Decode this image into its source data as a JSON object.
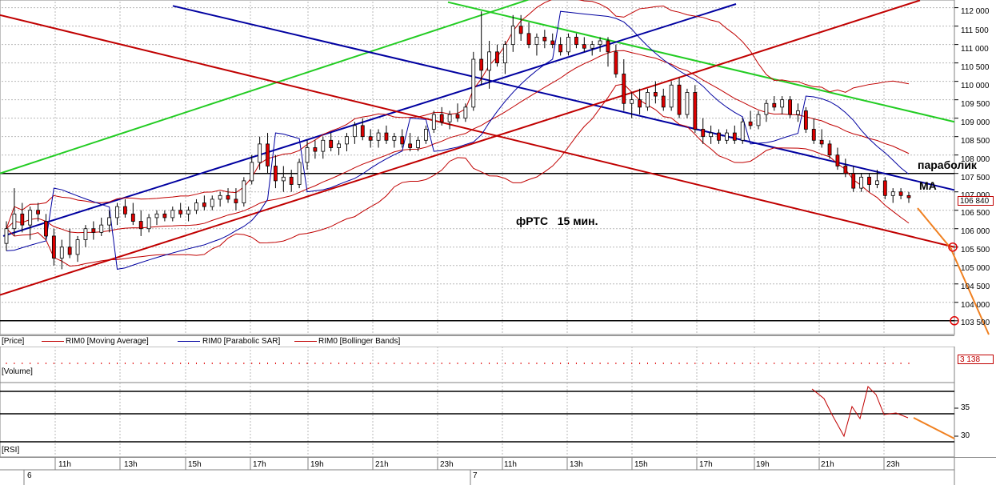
{
  "chart_data": {
    "type": "candlestick",
    "title": "фРТС   15 мин.",
    "instrument": "RIM0",
    "timeframe": "15 мин.",
    "price_axis": {
      "range": [
        103300,
        112100
      ],
      "ticks": [
        "112 000",
        "111 500",
        "111 000",
        "110 500",
        "110 000",
        "109 500",
        "109 000",
        "108 500",
        "108 000",
        "107 500",
        "107 000",
        "106 500",
        "106 000",
        "105 500",
        "105 000",
        "104 500",
        "104 000",
        "103 500"
      ],
      "tick_values": [
        112000,
        111500,
        111000,
        110500,
        110000,
        109500,
        109000,
        108500,
        108000,
        107500,
        107000,
        106500,
        106000,
        105500,
        105000,
        104500,
        104000,
        103500
      ],
      "last_price": "106 840"
    },
    "volume_axis": {
      "last_value": "3 138"
    },
    "rsi_axis": {
      "ticks": [
        "35",
        "30"
      ],
      "tick_values": [
        35,
        30
      ],
      "levels": [
        38,
        34,
        29
      ]
    },
    "time_axis": {
      "hours": [
        "11h",
        "13h",
        "15h",
        "17h",
        "19h",
        "21h",
        "23h",
        "11h",
        "13h",
        "15h",
        "17h",
        "19h",
        "21h",
        "23h"
      ],
      "days": [
        "6",
        "7"
      ]
    },
    "legend": [
      {
        "label": "[Price]",
        "color": "#000000"
      },
      {
        "label": "RIM0 [Moving Average]",
        "color": "#c00000"
      },
      {
        "label": "RIM0 [Parabolic SAR]",
        "color": "#0000a0"
      },
      {
        "label": "RIM0 [Bollinger Bands]",
        "color": "#c00000"
      }
    ],
    "pane_labels": {
      "volume": "[Volume]",
      "rsi": "[RSI]"
    },
    "annotations": {
      "parabolic": "параболик",
      "ma": "МА"
    },
    "candles": [
      [
        105600,
        106200,
        105400,
        106000
      ],
      [
        106000,
        107100,
        105800,
        106400
      ],
      [
        106400,
        106700,
        105900,
        106100
      ],
      [
        106100,
        106600,
        105700,
        106500
      ],
      [
        106500,
        106700,
        106200,
        106400
      ],
      [
        106200,
        106400,
        105700,
        105800
      ],
      [
        105800,
        106000,
        105000,
        105200
      ],
      [
        105200,
        105700,
        104900,
        105500
      ],
      [
        105500,
        106000,
        105200,
        105300
      ],
      [
        105300,
        105800,
        105100,
        105700
      ],
      [
        105700,
        106100,
        105500,
        106000
      ],
      [
        106000,
        106200,
        105700,
        105900
      ],
      [
        105900,
        106300,
        105800,
        106100
      ],
      [
        106100,
        106500,
        105900,
        106300
      ],
      [
        106300,
        106700,
        106100,
        106600
      ],
      [
        106600,
        106800,
        106300,
        106400
      ],
      [
        106400,
        106700,
        106100,
        106200
      ],
      [
        106200,
        106500,
        105800,
        106000
      ],
      [
        106000,
        106400,
        105900,
        106300
      ],
      [
        106300,
        106500,
        106100,
        106400
      ],
      [
        106400,
        106500,
        106200,
        106300
      ],
      [
        106300,
        106600,
        106200,
        106500
      ],
      [
        106500,
        106700,
        106300,
        106400
      ],
      [
        106400,
        106600,
        106200,
        106500
      ],
      [
        106500,
        106800,
        106400,
        106700
      ],
      [
        106700,
        106900,
        106500,
        106600
      ],
      [
        106600,
        106900,
        106500,
        106800
      ],
      [
        106800,
        107000,
        106600,
        106900
      ],
      [
        106900,
        107100,
        106700,
        106800
      ],
      [
        106800,
        107100,
        106500,
        106700
      ],
      [
        106700,
        107400,
        106600,
        107300
      ],
      [
        107300,
        108000,
        107200,
        107800
      ],
      [
        107800,
        108500,
        107600,
        108300
      ],
      [
        108300,
        108600,
        107500,
        107700
      ],
      [
        107700,
        108000,
        107100,
        107300
      ],
      [
        107300,
        107700,
        107000,
        107400
      ],
      [
        107400,
        107600,
        107000,
        107200
      ],
      [
        107200,
        107900,
        107100,
        107800
      ],
      [
        107800,
        108400,
        107600,
        108200
      ],
      [
        108200,
        108400,
        107900,
        108100
      ],
      [
        108100,
        108500,
        107900,
        108400
      ],
      [
        108400,
        108600,
        108100,
        108200
      ],
      [
        108200,
        108400,
        108000,
        108300
      ],
      [
        108300,
        108600,
        108100,
        108500
      ],
      [
        108500,
        108900,
        108300,
        108800
      ],
      [
        108800,
        109000,
        108400,
        108500
      ],
      [
        108500,
        108700,
        108200,
        108400
      ],
      [
        108400,
        108700,
        108200,
        108600
      ],
      [
        108600,
        108800,
        108300,
        108400
      ],
      [
        108400,
        108600,
        108200,
        108500
      ],
      [
        108500,
        108700,
        108200,
        108300
      ],
      [
        108300,
        108600,
        108100,
        108200
      ],
      [
        108200,
        108500,
        108100,
        108400
      ],
      [
        108400,
        108800,
        108300,
        108700
      ],
      [
        108700,
        109200,
        108600,
        109100
      ],
      [
        109100,
        109300,
        108800,
        108900
      ],
      [
        108900,
        109200,
        108700,
        109100
      ],
      [
        109100,
        109400,
        108900,
        109000
      ],
      [
        109000,
        109400,
        108900,
        109300
      ],
      [
        109300,
        110800,
        109200,
        110600
      ],
      [
        110600,
        111900,
        109900,
        110300
      ],
      [
        110300,
        111100,
        109800,
        110800
      ],
      [
        110800,
        111000,
        110400,
        110500
      ],
      [
        110500,
        111100,
        110200,
        111000
      ],
      [
        111000,
        111800,
        110800,
        111500
      ],
      [
        111500,
        111800,
        111100,
        111300
      ],
      [
        111300,
        111600,
        110900,
        111000
      ],
      [
        111000,
        111300,
        110700,
        111200
      ],
      [
        111200,
        111400,
        110900,
        111100
      ],
      [
        111100,
        111300,
        110900,
        111000
      ],
      [
        111000,
        111200,
        110700,
        110800
      ],
      [
        110800,
        111300,
        110700,
        111200
      ],
      [
        111200,
        111300,
        110900,
        111000
      ],
      [
        111000,
        111200,
        110800,
        110900
      ],
      [
        110900,
        111100,
        110700,
        111000
      ],
      [
        111000,
        111200,
        110800,
        111100
      ],
      [
        111100,
        111200,
        110400,
        110800
      ],
      [
        110800,
        111000,
        110100,
        110200
      ],
      [
        110200,
        110600,
        109200,
        109400
      ],
      [
        109400,
        109700,
        109000,
        109500
      ],
      [
        109500,
        109800,
        109100,
        109300
      ],
      [
        109300,
        109800,
        109200,
        109700
      ],
      [
        109700,
        110000,
        109400,
        109600
      ],
      [
        109600,
        109800,
        109200,
        109300
      ],
      [
        109300,
        110000,
        109200,
        109900
      ],
      [
        109900,
        110100,
        109000,
        109100
      ],
      [
        109100,
        109800,
        109000,
        109700
      ],
      [
        109700,
        109900,
        108600,
        108700
      ],
      [
        108700,
        109000,
        108300,
        108500
      ],
      [
        108500,
        108800,
        108300,
        108600
      ],
      [
        108600,
        108700,
        108300,
        108400
      ],
      [
        108400,
        108700,
        108300,
        108600
      ],
      [
        108600,
        108800,
        108300,
        108400
      ],
      [
        108400,
        109000,
        108300,
        108900
      ],
      [
        108900,
        109200,
        108700,
        108800
      ],
      [
        108800,
        109200,
        108700,
        109100
      ],
      [
        109100,
        109500,
        108900,
        109400
      ],
      [
        109400,
        109600,
        109200,
        109300
      ],
      [
        109300,
        109600,
        109100,
        109500
      ],
      [
        109500,
        109600,
        109000,
        109100
      ],
      [
        109100,
        109400,
        108900,
        109200
      ],
      [
        109200,
        109300,
        108600,
        108700
      ],
      [
        108700,
        109000,
        108300,
        108400
      ],
      [
        108400,
        108700,
        108200,
        108300
      ],
      [
        108300,
        108400,
        107900,
        108000
      ],
      [
        108000,
        108200,
        107600,
        107700
      ],
      [
        107700,
        107900,
        107400,
        107500
      ],
      [
        107500,
        107700,
        107000,
        107100
      ],
      [
        107100,
        107500,
        107000,
        107400
      ],
      [
        107400,
        107500,
        107000,
        107200
      ],
      [
        107200,
        107600,
        107100,
        107300
      ],
      [
        107300,
        107400,
        106800,
        106900
      ],
      [
        106900,
        107100,
        106700,
        107000
      ],
      [
        107000,
        107100,
        106800,
        106900
      ],
      [
        106900,
        107000,
        106700,
        106840
      ]
    ]
  }
}
